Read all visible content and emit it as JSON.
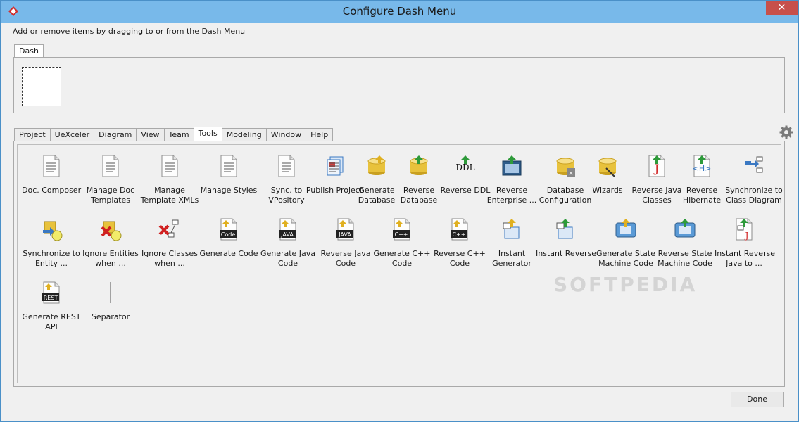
{
  "window": {
    "title": "Configure Dash Menu",
    "close_glyph": "✕"
  },
  "instruction": "Add or remove items by dragging to or from the Dash Menu",
  "dash": {
    "tab_label": "Dash"
  },
  "tabs": [
    {
      "label": "Project"
    },
    {
      "label": "UeXceler"
    },
    {
      "label": "Diagram"
    },
    {
      "label": "View"
    },
    {
      "label": "Team"
    },
    {
      "label": "Tools",
      "active": true
    },
    {
      "label": "Modeling"
    },
    {
      "label": "Window"
    },
    {
      "label": "Help"
    }
  ],
  "items": [
    {
      "l1": "Doc. Composer",
      "l2": "",
      "icon": "document-icon"
    },
    {
      "l1": "Manage Doc",
      "l2": "Templates",
      "icon": "document-icon"
    },
    {
      "l1": "Manage",
      "l2": "Template XMLs",
      "icon": "document-icon"
    },
    {
      "l1": "Manage Styles",
      "l2": "",
      "icon": "document-icon"
    },
    {
      "l1": "Sync. to",
      "l2": "VPository",
      "icon": "document-icon"
    },
    {
      "l1": "Publish Project",
      "l2": "",
      "icon": "publish-icon"
    },
    {
      "l1": "Generate",
      "l2": "Database",
      "icon": "database-icon"
    },
    {
      "l1": "Reverse",
      "l2": "Database",
      "icon": "database-reverse-icon"
    },
    {
      "l1": "Reverse DDL",
      "l2": "",
      "icon": "ddl-icon"
    },
    {
      "l1": "Reverse",
      "l2": "Enterprise ...",
      "icon": "enterprise-icon"
    },
    {
      "l1": "Database",
      "l2": "Configuration",
      "icon": "database-config-icon"
    },
    {
      "l1": "Wizards",
      "l2": "",
      "icon": "wizard-icon"
    },
    {
      "l1": "Reverse Java",
      "l2": "Classes",
      "icon": "java-icon"
    },
    {
      "l1": "Reverse",
      "l2": "Hibernate",
      "icon": "hibernate-icon"
    },
    {
      "l1": "Synchronize to",
      "l2": "Class Diagram",
      "icon": "sync-diagram-icon"
    },
    {
      "l1": "Synchronize to",
      "l2": "Entity ...",
      "icon": "sync-entity-icon"
    },
    {
      "l1": "Ignore Entities",
      "l2": "when ...",
      "icon": "ignore-entities-icon"
    },
    {
      "l1": "Ignore Classes",
      "l2": "when ...",
      "icon": "ignore-classes-icon"
    },
    {
      "l1": "Generate Code",
      "l2": "",
      "icon": "code-icon",
      "badge": "Code"
    },
    {
      "l1": "Generate Java",
      "l2": "Code",
      "icon": "java-code-icon",
      "badge": "JAVA"
    },
    {
      "l1": "Reverse Java",
      "l2": "Code",
      "icon": "java-reverse-icon",
      "badge": "JAVA"
    },
    {
      "l1": "Generate C++",
      "l2": "Code",
      "icon": "cpp-code-icon",
      "badge": "C++"
    },
    {
      "l1": "Reverse C++",
      "l2": "Code",
      "icon": "cpp-reverse-icon",
      "badge": "C++"
    },
    {
      "l1": "Instant",
      "l2": "Generator",
      "icon": "instant-generator-icon"
    },
    {
      "l1": "Instant Reverse",
      "l2": "",
      "icon": "instant-reverse-icon"
    },
    {
      "l1": "Generate State",
      "l2": "Machine Code",
      "icon": "state-machine-icon"
    },
    {
      "l1": "Reverse State",
      "l2": "Machine Code",
      "icon": "state-machine-reverse-icon"
    },
    {
      "l1": "Instant Reverse",
      "l2": "Java to ...",
      "icon": "instant-reverse-java-icon"
    },
    {
      "l1": "Generate REST",
      "l2": "API",
      "icon": "rest-icon",
      "badge": "REST"
    },
    {
      "l1": "Separator",
      "l2": "",
      "icon": "separator-icon"
    }
  ],
  "done_label": "Done",
  "watermark": "SOFTPEDIA",
  "colors": {
    "accent": "#78b9ea",
    "close": "#c7504b",
    "db_yellow": "#e8c23c",
    "doc_blue": "#3a78c2"
  }
}
